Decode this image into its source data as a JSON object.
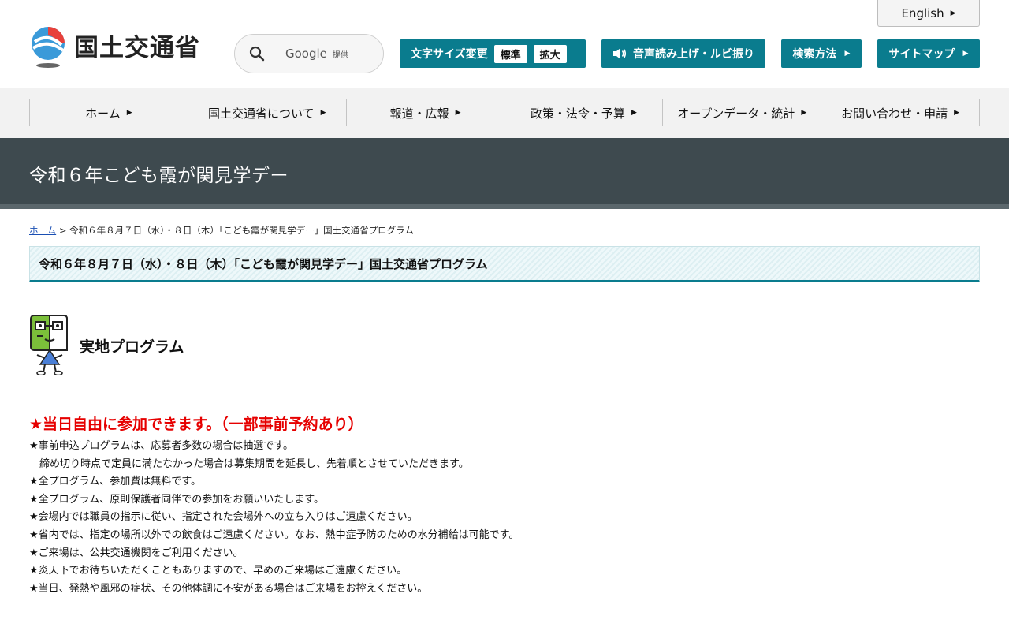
{
  "header": {
    "site_name": "国土交通省",
    "english_label": "English",
    "search": {
      "provider": "Google",
      "provided_label": "提供"
    },
    "font_size": {
      "label": "文字サイズ変更",
      "standard": "標準",
      "large": "拡大"
    },
    "voice_label": "音声読み上げ・ルビ振り",
    "search_method_label": "検索方法",
    "sitemap_label": "サイトマップ"
  },
  "nav": {
    "items": [
      {
        "label": "ホーム"
      },
      {
        "label": "国土交通省について"
      },
      {
        "label": "報道・広報"
      },
      {
        "label": "政策・法令・予算"
      },
      {
        "label": "オープンデータ・統計"
      },
      {
        "label": "お問い合わせ・申請"
      }
    ]
  },
  "page": {
    "title": "令和６年こども霞が関見学デー",
    "breadcrumb": {
      "home": "ホーム",
      "separator": ">",
      "current": "令和６年８月７日（水）・８日（木）「こども霞が関見学デー」国土交通省プログラム"
    },
    "heading": "令和６年８月７日（水）・８日（木）「こども霞が関見学デー」国土交通省プログラム",
    "section_title": "実地プログラム",
    "notice_title": "★当日自由に参加できます。（一部事前予約あり）",
    "notes": [
      "★事前申込プログラムは、応募者多数の場合は抽選です。",
      "　締め切り時点で定員に満たなかった場合は募集期間を延長し、先着順とさせていただきます。",
      "★全プログラム、参加費は無料です。",
      "★全プログラム、原則保護者同伴での参加をお願いいたします。",
      "★会場内では職員の指示に従い、指定された会場外への立ち入りはご遠慮ください。",
      "★省内では、指定の場所以外での飲食はご遠慮ください。なお、熱中症予防のための水分補給は可能です。",
      "★ご来場は、公共交通機関をご利用ください。",
      "★炎天下でお待ちいただくこともありますので、早めのご来場はご遠慮ください。",
      "★当日、発熱や風邪の症状、その他体調に不安がある場合はご来場をお控えください。"
    ]
  },
  "colors": {
    "teal": "#0a7c8e",
    "title_band": "#3e4a4f",
    "notice_red": "#e60000"
  }
}
